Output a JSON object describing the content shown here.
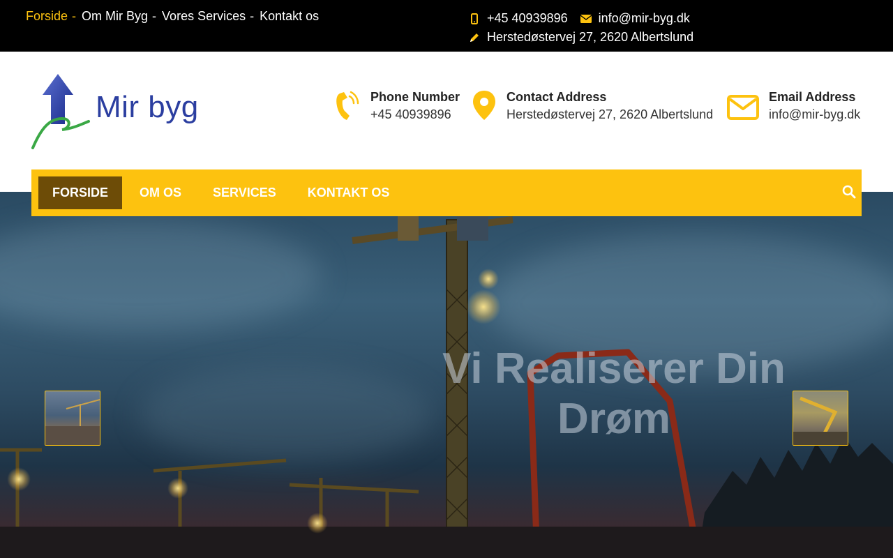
{
  "topbar": {
    "nav": [
      {
        "label": "Forside",
        "active": true
      },
      {
        "label": "Om Mir Byg",
        "active": false
      },
      {
        "label": "Vores Services",
        "active": false
      },
      {
        "label": "Kontakt os",
        "active": false
      }
    ],
    "separator": "-",
    "phone": "+45 40939896",
    "email": "info@mir-byg.dk",
    "address": "Herstedøstervej 27, 2620 Albertslund"
  },
  "header": {
    "logo_text": "Mir byg",
    "phone": {
      "title": "Phone Number",
      "value": "+45 40939896",
      "icon": "phone-icon"
    },
    "address": {
      "title": "Contact Address",
      "value": "Herstedøstervej 27, 2620 Albertslund",
      "icon": "map-marker-icon"
    },
    "email": {
      "title": "Email Address",
      "value": "info@mir-byg.dk",
      "icon": "envelope-icon"
    }
  },
  "mainnav": {
    "items": [
      {
        "label": "FORSIDE",
        "active": true
      },
      {
        "label": "OM OS",
        "active": false
      },
      {
        "label": "SERVICES",
        "active": false
      },
      {
        "label": "KONTAKT OS",
        "active": false
      }
    ],
    "search_icon": "search-icon"
  },
  "hero": {
    "title_line1": "Vi Realiserer Din",
    "title_line2": "Drøm"
  },
  "colors": {
    "accent": "#fdc20f",
    "nav_active": "#6d4c07",
    "topbar_bg": "#000000",
    "logo_blue": "#2b3ea0",
    "logo_green": "#3aa845"
  }
}
